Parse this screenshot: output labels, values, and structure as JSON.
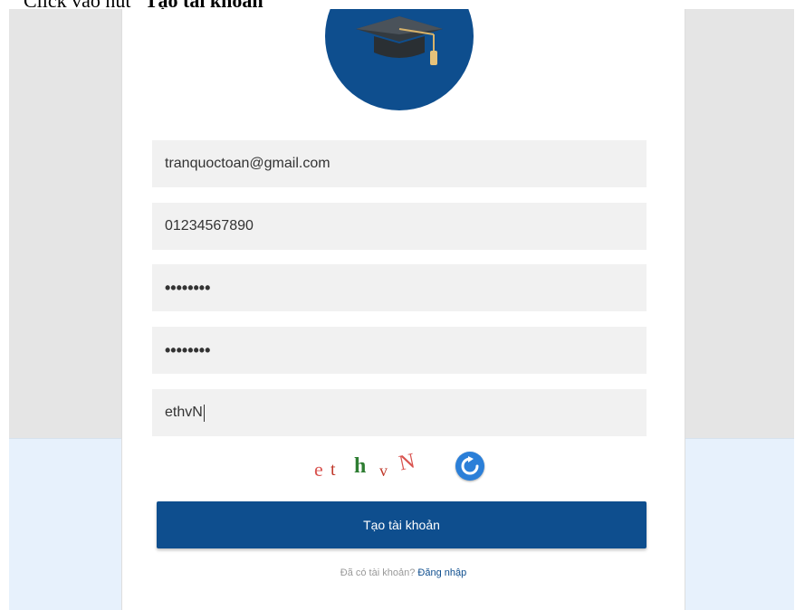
{
  "caption": {
    "prefix": "Click vào nút",
    "bold": "Tạo tài khoản"
  },
  "form": {
    "email": "tranquoctoan@gmail.com",
    "phone": "01234567890",
    "password_mask": "••••••••",
    "confirm_password_mask": "••••••••",
    "captcha_input": "ethvN"
  },
  "captcha": {
    "chars": [
      "e",
      "t",
      "h",
      "v",
      "N"
    ],
    "colors": [
      "#d9534f",
      "#c0392b",
      "#2e7d32",
      "#c0392b",
      "#d9534f"
    ],
    "refresh_icon": "refresh-icon"
  },
  "submit_label": "Tạo tài khoản",
  "footer": {
    "question": "Đã có tài khoản?",
    "login_link": "Đăng nhập"
  },
  "logo_icon": "graduation-cap-icon",
  "colors": {
    "brand": "#0e4e8e",
    "field_bg": "#f1f1f1",
    "page_bg_top": "#e5e5e5",
    "page_bg_bottom": "#e7f1fc"
  }
}
